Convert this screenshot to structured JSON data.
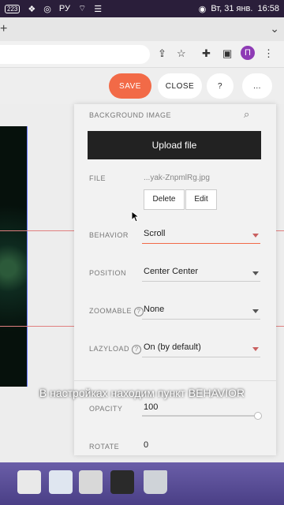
{
  "menubar": {
    "badge": "223",
    "lang": "РУ",
    "datetime": "Вт, 31 янв.",
    "time": "16:58"
  },
  "browser": {
    "new_tab": "+",
    "profile_initial": "П"
  },
  "toolbar": {
    "save_label": "SAVE",
    "close_label": "CLOSE",
    "help_label": "?",
    "more_label": "..."
  },
  "panel": {
    "background_image_label": "BACKGROUND IMAGE",
    "upload_label": "Upload file",
    "file_label": "FILE",
    "file_name": "...yak-ZnpmlRg.jpg",
    "delete_label": "Delete",
    "edit_label": "Edit",
    "behavior_label": "BEHAVIOR",
    "behavior_value": "Scroll",
    "position_label": "POSITION",
    "position_value": "Center Center",
    "zoomable_label": "ZOOMABLE",
    "zoomable_value": "None",
    "lazyload_label": "LAZYLOAD",
    "lazyload_value": "On (by default)",
    "opacity_label": "OPACITY",
    "opacity_value": "100",
    "rotate_label": "ROTATE",
    "rotate_value": "0"
  },
  "caption": "В настройках находим пункт BEHAVIOR",
  "colors": {
    "accent": "#f26a47",
    "dark_button": "#222222",
    "guide": "#e08080"
  }
}
